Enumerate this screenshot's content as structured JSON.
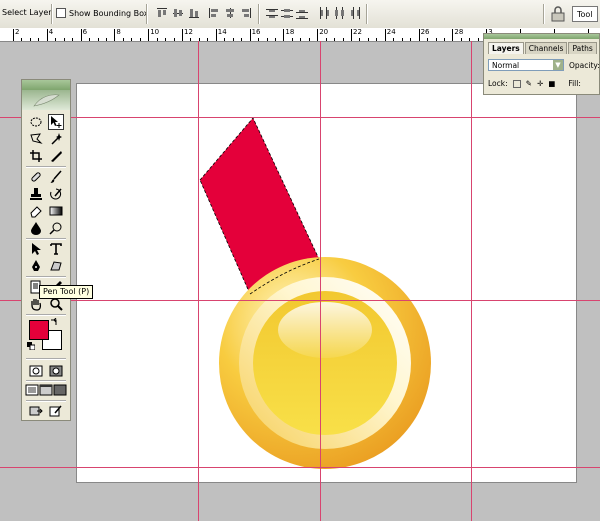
{
  "options_bar": {
    "auto_select_layer": "Select Layer",
    "show_bounding_box": "Show Bounding Box",
    "tools_tab": "Tool"
  },
  "ruler": {
    "labels": [
      "2",
      "4",
      "6",
      "8",
      "10",
      "12",
      "14",
      "16",
      "18",
      "20",
      "22",
      "24",
      "26",
      "28",
      "3"
    ]
  },
  "tooltip": "Pen Tool (P)",
  "colors": {
    "foreground": "#e4003a",
    "background": "#ffffff",
    "guide": "#d8446f",
    "ribbon": "#e4003a",
    "medal_rim": "#f5b52c",
    "medal_center": "#f6d535"
  },
  "layers_panel": {
    "tabs": [
      "Layers",
      "Channels",
      "Paths"
    ],
    "blend_mode": "Normal",
    "opacity_label": "Opacity:",
    "lock_label": "Lock:",
    "fill_label": "Fill:"
  }
}
